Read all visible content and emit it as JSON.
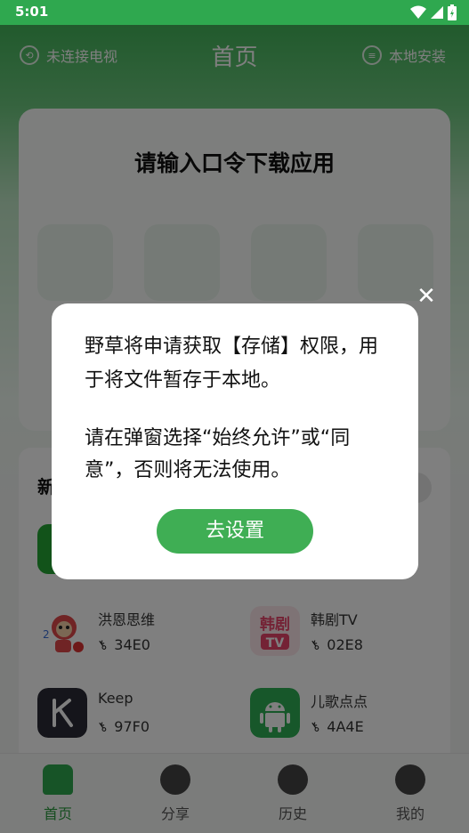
{
  "status_bar": {
    "time": "5:01"
  },
  "header": {
    "left_label": "未连接电视",
    "title": "首页",
    "right_label": "本地安装"
  },
  "code_card": {
    "title": "请输入口令下载应用"
  },
  "section": {
    "title_partial": "新"
  },
  "apps": [
    {
      "name": "洪恩思维",
      "code": "34E0",
      "icon": "hongen-monkey-icon"
    },
    {
      "name": "韩剧TV",
      "code": "02E8",
      "icon": "hanju-tv-icon"
    },
    {
      "name": "Keep",
      "code": "97F0",
      "icon": "keep-icon"
    },
    {
      "name": "儿歌点点",
      "code": "4A4E",
      "icon": "android-icon"
    }
  ],
  "nav": [
    {
      "label": "首页",
      "icon": "home-icon"
    },
    {
      "label": "分享",
      "icon": "compass-icon"
    },
    {
      "label": "历史",
      "icon": "clock-icon"
    },
    {
      "label": "我的",
      "icon": "user-icon"
    }
  ],
  "dialog": {
    "text1": "野草将申请获取【存储】权限，用于将文件暂存于本地。",
    "text2": "请在弹窗选择“始终允许”或“同意”，否则将无法使用。",
    "button": "去设置",
    "close": "✕"
  },
  "colors": {
    "accent": "#2fa84f",
    "button": "#3fae54"
  }
}
